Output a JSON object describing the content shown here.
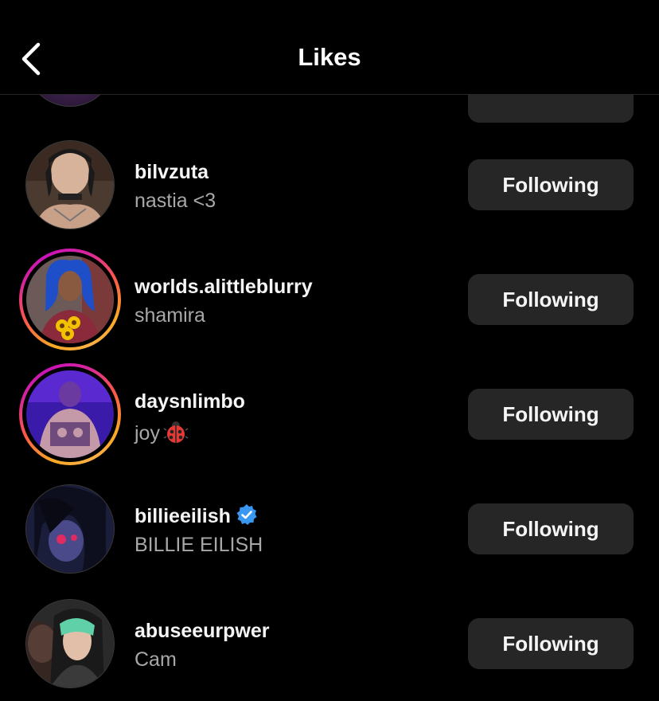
{
  "header": {
    "title": "Likes",
    "back_icon": "chevron-left-icon"
  },
  "colors": {
    "background": "#000000",
    "button_bg": "#262626",
    "secondary_text": "#a8a8a8",
    "verified_blue": "#3897f0"
  },
  "likes": [
    {
      "username": "bilvzuta",
      "fullname": "nastia <3",
      "button": "Following",
      "story_ring": false,
      "verified": false
    },
    {
      "username": "worlds.alittleblurry",
      "fullname": "shamira",
      "button": "Following",
      "story_ring": true,
      "verified": false
    },
    {
      "username": "daysnlimbo",
      "fullname": "joy",
      "fullname_emoji": "ladybug-icon",
      "button": "Following",
      "story_ring": true,
      "verified": false
    },
    {
      "username": "billieeilish",
      "fullname": "BILLIE EILISH",
      "button": "Following",
      "story_ring": false,
      "verified": true
    },
    {
      "username": "abuseeurpwer",
      "fullname": "Cam",
      "button": "Following",
      "story_ring": false,
      "verified": false
    }
  ]
}
